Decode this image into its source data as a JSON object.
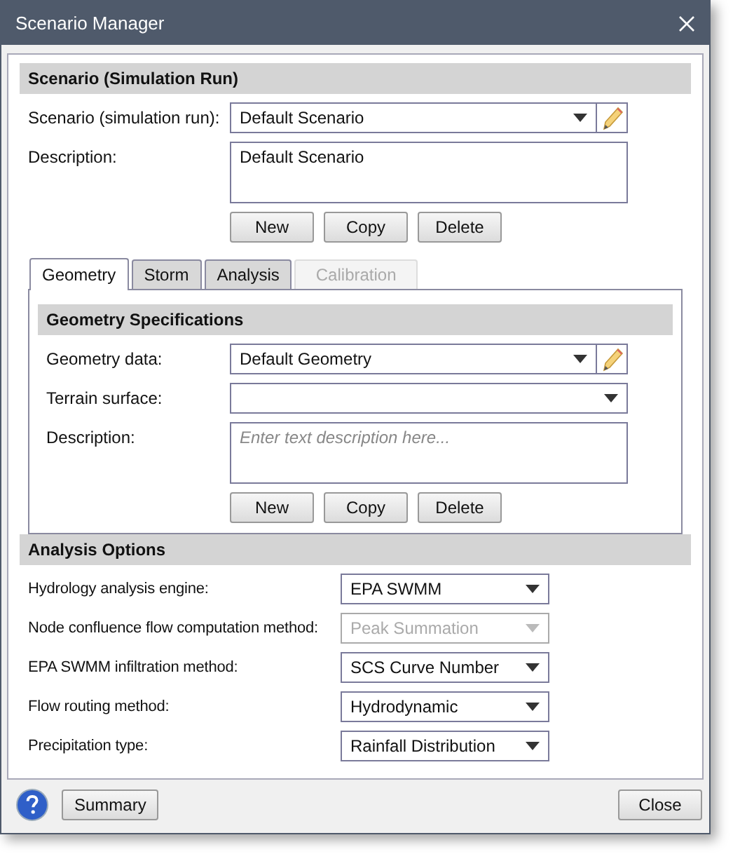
{
  "window": {
    "title": "Scenario Manager"
  },
  "scenario_section": {
    "title": "Scenario (Simulation Run)",
    "fields": [
      {
        "kind": "combo_edit",
        "label": "Scenario (simulation run):",
        "value": "Default Scenario"
      },
      {
        "kind": "textarea",
        "label": "Description:",
        "value": "Default Scenario"
      }
    ],
    "buttons": [
      "New",
      "Copy",
      "Delete"
    ]
  },
  "tabs": [
    {
      "label": "Geometry",
      "selected": true,
      "disabled": false
    },
    {
      "label": "Storm",
      "selected": false,
      "disabled": false
    },
    {
      "label": "Analysis",
      "selected": false,
      "disabled": false
    },
    {
      "label": "Calibration",
      "selected": false,
      "disabled": true
    }
  ],
  "geometry_section": {
    "title": "Geometry Specifications",
    "fields": [
      {
        "kind": "combo_edit",
        "label": "Geometry data:",
        "value": "Default Geometry"
      },
      {
        "kind": "combo",
        "label": "Terrain surface:"
      },
      {
        "kind": "textarea",
        "label": "Description:",
        "placeholder": "Enter text description here..."
      }
    ],
    "buttons": [
      "New",
      "Copy",
      "Delete"
    ]
  },
  "analysis_options": {
    "title": "Analysis Options",
    "rows": [
      {
        "label": "Hydrology analysis engine:",
        "value": "EPA SWMM",
        "disabled": false
      },
      {
        "label": "Node confluence flow computation method:",
        "value": "Peak Summation",
        "disabled": true
      },
      {
        "label": "EPA SWMM infiltration method:",
        "value": "SCS Curve Number",
        "disabled": false
      },
      {
        "label": "Flow routing method:",
        "value": "Hydrodynamic",
        "disabled": false
      },
      {
        "label": "Precipitation type:",
        "value": "Rainfall Distribution",
        "disabled": false
      }
    ]
  },
  "footer": {
    "summary_button": "Summary",
    "close_button": "Close"
  }
}
